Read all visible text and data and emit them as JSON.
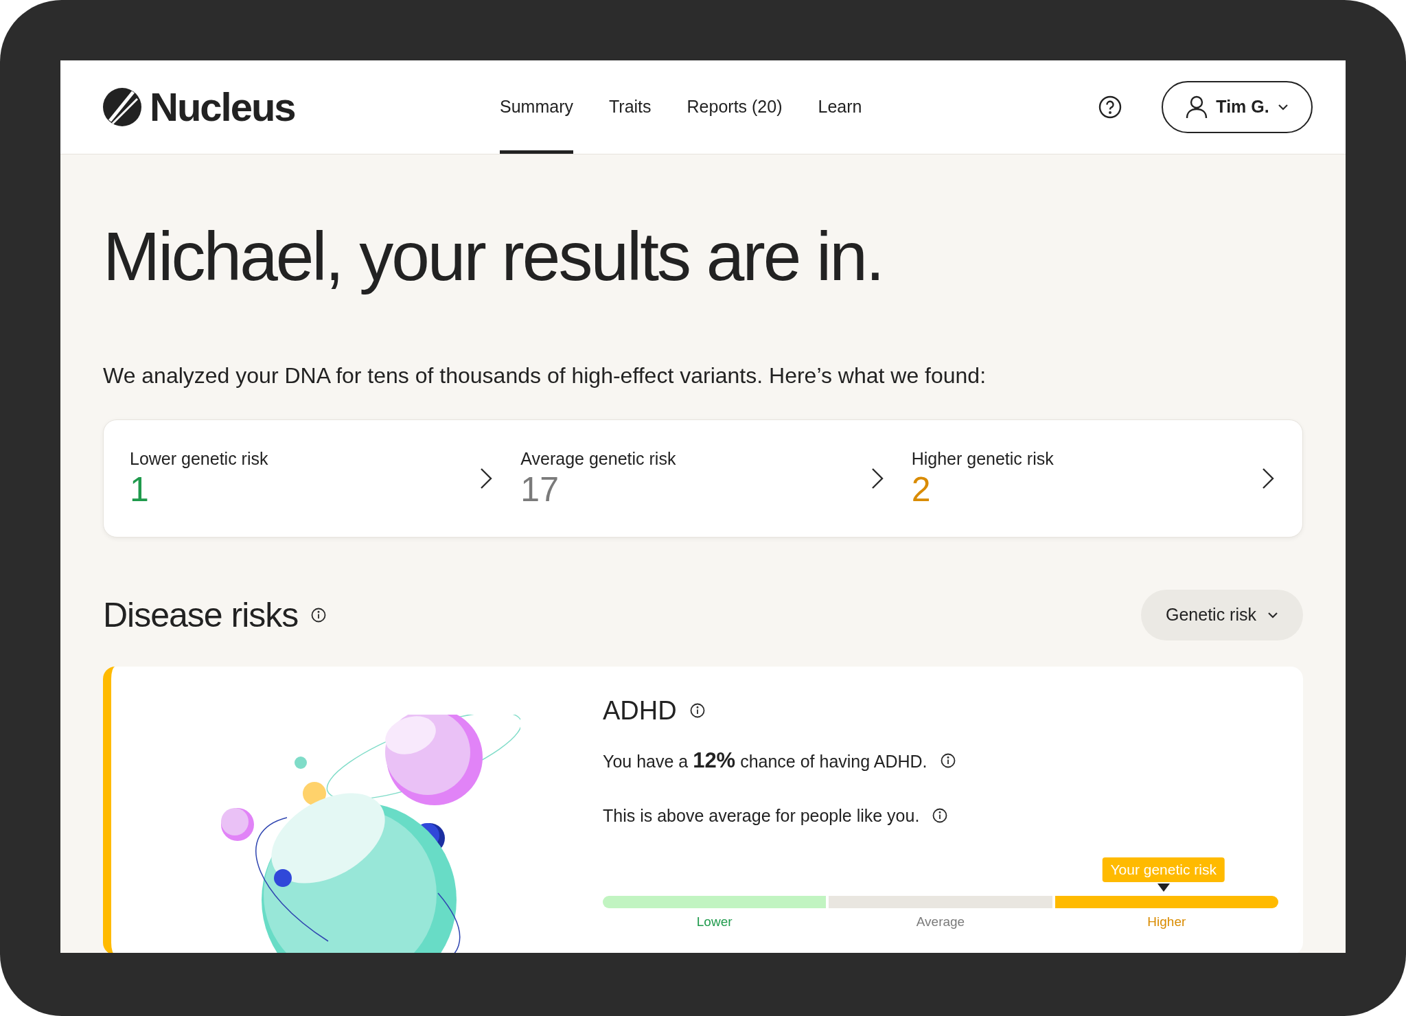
{
  "header": {
    "logo": "Nucleus",
    "tabs": [
      {
        "label": "Summary",
        "selected": true
      },
      {
        "label": "Traits",
        "selected": false
      },
      {
        "label": "Reports (20)",
        "selected": false
      },
      {
        "label": "Learn",
        "selected": false
      }
    ],
    "user": "Tim G."
  },
  "headline": "Michael, your results are in.",
  "intro": "We analyzed your DNA for tens of thousands of high-effect variants. Here’s what we found:",
  "summary": [
    {
      "label": "Lower genetic risk",
      "value": "1",
      "color": "#1f9a4c"
    },
    {
      "label": "Average genetic risk",
      "value": "17",
      "color": "#7a7a7a"
    },
    {
      "label": "Higher genetic risk",
      "value": "2",
      "color": "#d98b00"
    }
  ],
  "section": {
    "title": "Disease risks",
    "filter": "Genetic risk"
  },
  "result": {
    "title": "ADHD",
    "chance": "You have a **12%** chance of having ADHD.",
    "comparison": "This is above average for people like you.",
    "scale": {
      "marker_label": "Your genetic risk",
      "level": 0.83,
      "segments": [
        {
          "bar": {
            "color": "#c1f4c1"
          },
          "label": {
            "text": "Lower",
            "color": "#1f9a4c"
          }
        },
        {
          "bar": {
            "color": "#e9e6e0"
          },
          "label": {
            "text": "Average",
            "color": "#7a7a7a"
          }
        },
        {
          "bar": {
            "color": "#ffba00"
          },
          "label": {
            "text": "Higher",
            "color": "#d98b00"
          }
        }
      ]
    }
  }
}
